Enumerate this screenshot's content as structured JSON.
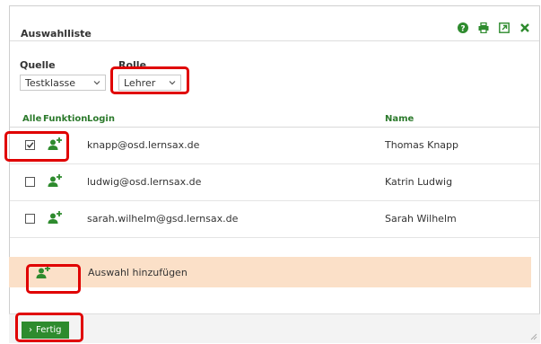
{
  "dialog": {
    "title": "Auswahlliste",
    "icons": [
      "help-icon",
      "print-icon",
      "popout-icon",
      "close-icon"
    ]
  },
  "filters": {
    "quelle_label": "Quelle",
    "quelle_value": "Testklasse",
    "rolle_label": "Rolle",
    "rolle_value": "Lehrer"
  },
  "table": {
    "headers": {
      "alle": "Alle",
      "funktion": "Funktion",
      "login": "Login",
      "name": "Name"
    },
    "rows": [
      {
        "checked": true,
        "login": "knapp@osd.lernsax.de",
        "name": "Thomas Knapp"
      },
      {
        "checked": false,
        "login": "ludwig@osd.lernsax.de",
        "name": "Katrin Ludwig"
      },
      {
        "checked": false,
        "login": "sarah.wilhelm@gsd.lernsax.de",
        "name": "Sarah Wilhelm"
      }
    ]
  },
  "add_selection": {
    "label": "Auswahl hinzufügen"
  },
  "footer": {
    "done_label": "Fertig"
  },
  "colors": {
    "accent_green": "#2e8b2e",
    "highlight_red": "#e00000",
    "add_bar": "#fbe0c8"
  }
}
